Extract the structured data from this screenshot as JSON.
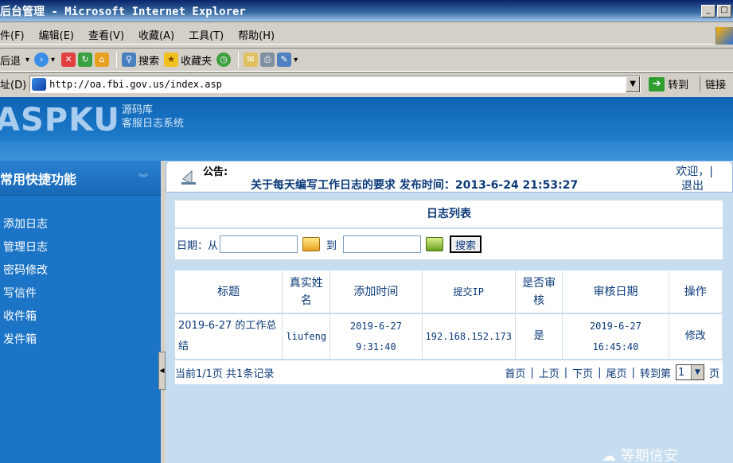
{
  "window": {
    "title": "后台管理 - Microsoft Internet Explorer",
    "min_glyph": "_",
    "max_glyph": "□"
  },
  "menu": [
    {
      "label": "件(F)"
    },
    {
      "label": "编辑(E)"
    },
    {
      "label": "查看(V)"
    },
    {
      "label": "收藏(A)"
    },
    {
      "label": "工具(T)"
    },
    {
      "label": "帮助(H)"
    }
  ],
  "toolbar": {
    "back": "后退",
    "search": "搜索",
    "favorites": "收藏夹"
  },
  "address": {
    "label": "址(D)",
    "url": "http://oa.fbi.gov.us/index.asp",
    "go": "转到",
    "links": "链接"
  },
  "brand": {
    "logo": "ASPKU",
    "line1": "源码库",
    "line2": "客服日志系统"
  },
  "sidebar": {
    "header": "常用快捷功能",
    "items": [
      {
        "label": "添加日志"
      },
      {
        "label": "管理日志"
      },
      {
        "label": "密码修改"
      },
      {
        "label": "写信件"
      },
      {
        "label": "收件箱"
      },
      {
        "label": "发件箱"
      }
    ]
  },
  "notice": {
    "label": "公告:",
    "text": "关于每天编写工作日志的要求 发布时间：2013-6-24 21:53:27",
    "welcome": "欢迎，|",
    "logout": "退出"
  },
  "log_list": {
    "title": "日志列表",
    "date_from_label": "日期：从",
    "date_to_label": "到",
    "search_button": "搜索",
    "columns": [
      "标题",
      "真实姓名",
      "添加时间",
      "提交IP",
      "是否审核",
      "审核日期",
      "操作"
    ],
    "rows": [
      {
        "title": "2019-6-27 的工作总结",
        "name": "liufeng",
        "added": "2019-6-27 9:31:40",
        "ip": "192.168.152.173",
        "audited": "是",
        "audit_date": "2019-6-27 16:45:40",
        "action": "修改"
      }
    ],
    "pager": {
      "summary": "当前1/1页 共1条记录",
      "first": "首页",
      "prev": "上页",
      "next": "下页",
      "last": "尾页",
      "jump": "转到第",
      "page_value": "1",
      "page_suffix": "页"
    }
  },
  "watermark": "等期信安"
}
